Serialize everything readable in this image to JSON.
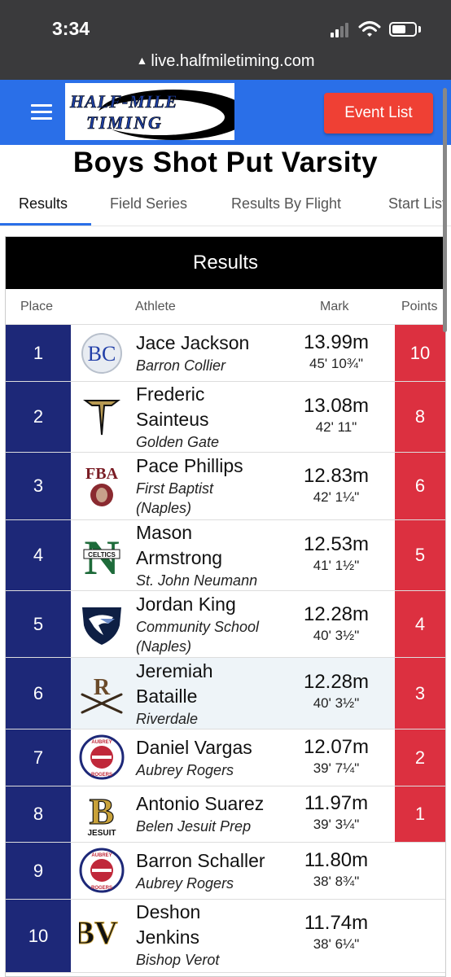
{
  "status_bar": {
    "time": "3:34"
  },
  "browser": {
    "url": "live.halfmiletiming.com"
  },
  "header": {
    "logo_line1": "HALF-MILE",
    "logo_line2": "TIMING",
    "event_list_label": "Event List"
  },
  "page": {
    "title": "Boys Shot Put Varsity"
  },
  "tabs": [
    {
      "label": "Results",
      "active": true
    },
    {
      "label": "Field Series"
    },
    {
      "label": "Results By Flight"
    },
    {
      "label": "Start List"
    }
  ],
  "results": {
    "heading": "Results",
    "columns": {
      "place": "Place",
      "athlete": "Athlete",
      "mark": "Mark",
      "points": "Points"
    },
    "rows": [
      {
        "place": "1",
        "name": "Jace Jackson",
        "team": "Barron Collier",
        "mark": "13.99m",
        "feet": "45' 10¾\"",
        "points": "10",
        "logo": "barron-collier-logo"
      },
      {
        "place": "2",
        "name": "Frederic Sainteus",
        "team": "Golden Gate",
        "mark": "13.08m",
        "feet": "42' 11\"",
        "points": "8",
        "logo": "golden-gate-logo"
      },
      {
        "place": "3",
        "name": "Pace Phillips",
        "team": "First Baptist (Naples)",
        "mark": "12.83m",
        "feet": "42' 1¼\"",
        "points": "6",
        "logo": "first-baptist-logo"
      },
      {
        "place": "4",
        "name": "Mason Armstrong",
        "team": "St. John Neumann",
        "mark": "12.53m",
        "feet": "41' 1½\"",
        "points": "5",
        "logo": "st-john-neumann-logo"
      },
      {
        "place": "5",
        "name": "Jordan King",
        "team": "Community School (Naples)",
        "mark": "12.28m",
        "feet": "40' 3½\"",
        "points": "4",
        "logo": "community-school-logo"
      },
      {
        "place": "6",
        "name": "Jeremiah Bataille",
        "team": "Riverdale",
        "mark": "12.28m",
        "feet": "40' 3½\"",
        "points": "3",
        "logo": "riverdale-logo"
      },
      {
        "place": "7",
        "name": "Daniel Vargas",
        "team": "Aubrey Rogers",
        "mark": "12.07m",
        "feet": "39' 7¼\"",
        "points": "2",
        "logo": "aubrey-rogers-logo"
      },
      {
        "place": "8",
        "name": "Antonio Suarez",
        "team": "Belen Jesuit Prep",
        "mark": "11.97m",
        "feet": "39' 3¼\"",
        "points": "1",
        "logo": "belen-jesuit-logo"
      },
      {
        "place": "9",
        "name": "Barron Schaller",
        "team": "Aubrey Rogers",
        "mark": "11.80m",
        "feet": "38' 8¾\"",
        "points": "",
        "logo": "aubrey-rogers-logo"
      },
      {
        "place": "10",
        "name": "Deshon Jenkins",
        "team": "Bishop Verot",
        "mark": "11.74m",
        "feet": "38' 6¼\"",
        "points": "",
        "logo": "bishop-verot-logo"
      }
    ],
    "logo_text": {
      "bc": "BC",
      "fba": "FBA",
      "n": "N",
      "celtics": "CELTICS",
      "r": "R",
      "b": "B",
      "jesuit": "JESUIT",
      "aubrey": "AUBREY",
      "rogers": "ROGERS",
      "bv": "BV"
    }
  },
  "colors": {
    "brand_blue": "#2a6fe8",
    "place_navy": "#1d2878",
    "points_red": "#dc3040",
    "button_red": "#ef4034"
  }
}
